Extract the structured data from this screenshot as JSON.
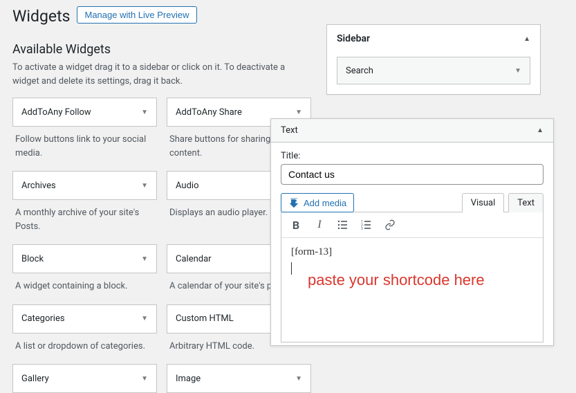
{
  "page": {
    "title": "Widgets",
    "manage_button": "Manage with Live Preview"
  },
  "available": {
    "heading": "Available Widgets",
    "help": "To activate a widget drag it to a sidebar or click on it. To deactivate a widget and delete its settings, drag it back.",
    "widgets": [
      {
        "name": "AddToAny Follow",
        "desc": "Follow buttons link to your social media."
      },
      {
        "name": "AddToAny Share",
        "desc": "Share buttons for sharing your content."
      },
      {
        "name": "Archives",
        "desc": "A monthly archive of your site's Posts."
      },
      {
        "name": "Audio",
        "desc": "Displays an audio player."
      },
      {
        "name": "Block",
        "desc": "A widget containing a block."
      },
      {
        "name": "Calendar",
        "desc": "A calendar of your site's p"
      },
      {
        "name": "Categories",
        "desc": "A list or dropdown of categories."
      },
      {
        "name": "Custom HTML",
        "desc": "Arbitrary HTML code."
      },
      {
        "name": "Gallery",
        "desc": ""
      },
      {
        "name": "Image",
        "desc": ""
      }
    ]
  },
  "sidebar": {
    "title": "Sidebar",
    "items": [
      {
        "name": "Search"
      }
    ]
  },
  "text_widget": {
    "header": "Text",
    "title_label": "Title:",
    "title_value": "Contact us",
    "add_media": "Add media",
    "tabs": {
      "visual": "Visual",
      "text": "Text"
    },
    "content": "[form-13]",
    "overlay": "paste your shortcode here"
  }
}
